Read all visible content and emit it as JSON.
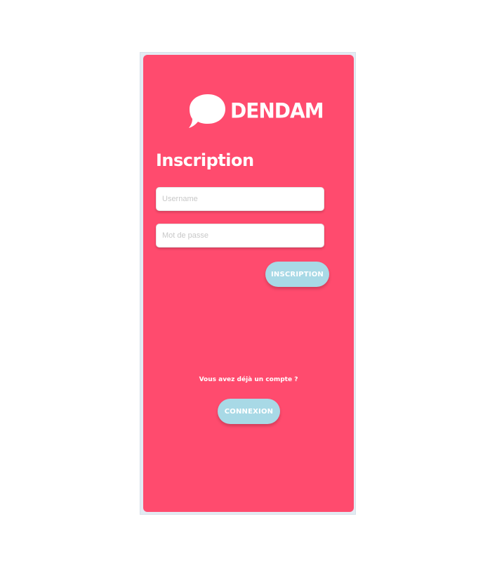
{
  "brand": {
    "name": "DENDAM",
    "logo_icon": "speech-bubble-icon"
  },
  "page": {
    "title": "Inscription"
  },
  "form": {
    "username_placeholder": "Username",
    "username_value": "",
    "password_placeholder": "Mot de passe",
    "password_value": "",
    "submit_label": "INSCRIPTION"
  },
  "footer": {
    "question": "Vous avez déjà un compte ?",
    "login_label": "CONNEXION"
  },
  "colors": {
    "card_background": "#ff4b6e",
    "button_background": "#a8d9e6",
    "text": "#ffffff"
  }
}
